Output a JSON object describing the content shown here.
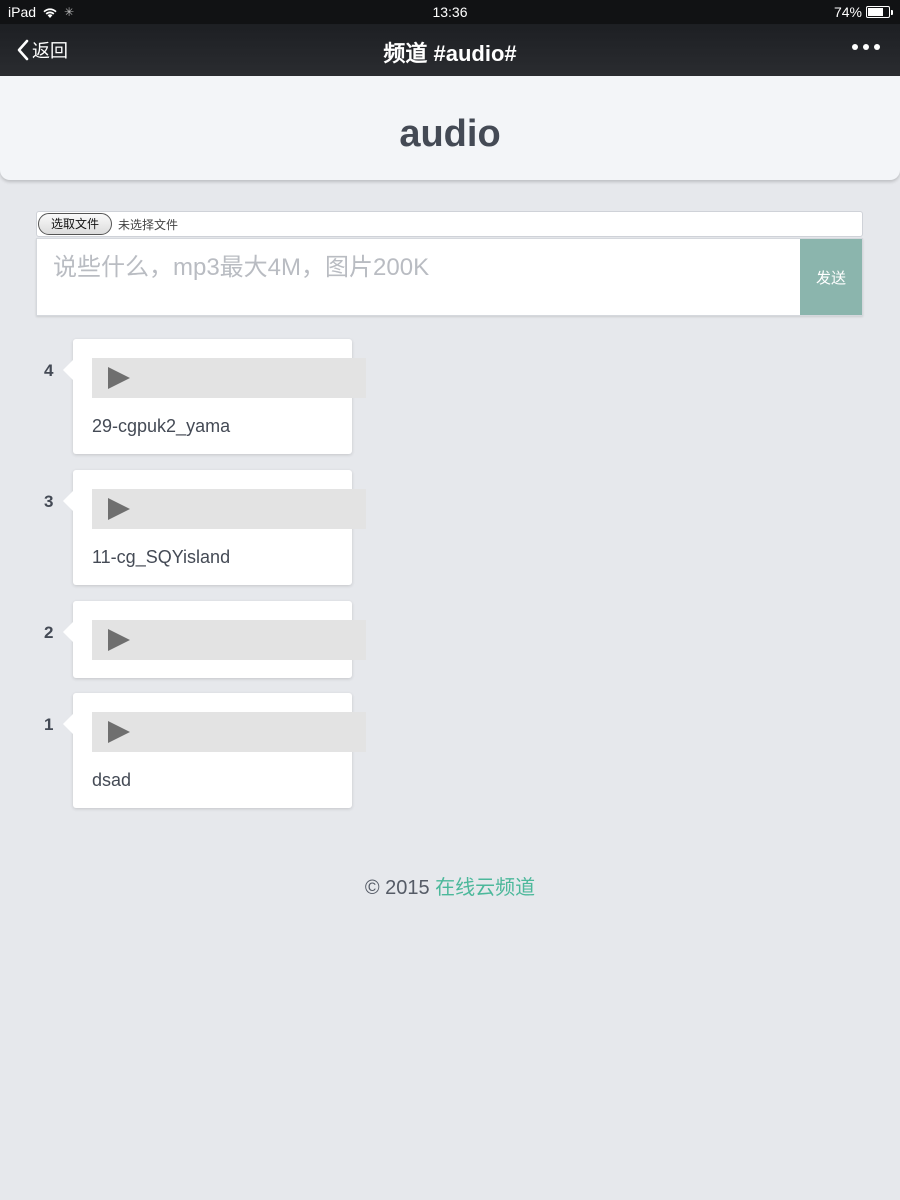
{
  "status_bar": {
    "device": "iPad",
    "time": "13:36",
    "battery_percent": "74%",
    "battery_level": 0.74
  },
  "nav": {
    "back_label": "返回",
    "title": "频道 #audio#",
    "more_icon": "ellipsis-icon"
  },
  "channel": {
    "name": "audio"
  },
  "composer": {
    "file_button": "选取文件",
    "file_status": "未选择文件",
    "placeholder": "说些什么，mp3最大4M，图片200K",
    "send_label": "发送"
  },
  "posts": [
    {
      "number": "4",
      "caption": "29-cgpuk2_yama"
    },
    {
      "number": "3",
      "caption": "11-cg_SQYisland"
    },
    {
      "number": "2",
      "caption": ""
    },
    {
      "number": "1",
      "caption": "dsad"
    }
  ],
  "footer": {
    "copyright": "© 2015 ",
    "link_text": "在线云频道"
  },
  "colors": {
    "accent": "#4cb89b",
    "send_button": "#8bb5ad",
    "background": "#e6e8ec"
  }
}
